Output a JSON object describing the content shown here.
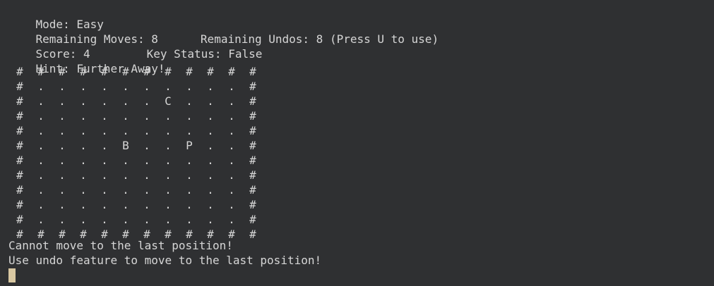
{
  "status": {
    "mode": "Mode: Easy",
    "remaining_moves": "Remaining Moves: 8",
    "remaining_undos": "Remaining Undos: 8 (Press U to use)",
    "score": "Score: 4",
    "key_status": "Key Status: False",
    "hint": "Hint: Further Away!"
  },
  "board": {
    "rows": [
      [
        "#",
        "#",
        "#",
        "#",
        "#",
        "#",
        "#",
        "#",
        "#",
        "#",
        "#",
        "#"
      ],
      [
        "#",
        ".",
        ".",
        ".",
        ".",
        ".",
        ".",
        ".",
        ".",
        ".",
        ".",
        "#"
      ],
      [
        "#",
        ".",
        ".",
        ".",
        ".",
        ".",
        ".",
        "C",
        ".",
        ".",
        ".",
        "#"
      ],
      [
        "#",
        ".",
        ".",
        ".",
        ".",
        ".",
        ".",
        ".",
        ".",
        ".",
        ".",
        "#"
      ],
      [
        "#",
        ".",
        ".",
        ".",
        ".",
        ".",
        ".",
        ".",
        ".",
        ".",
        ".",
        "#"
      ],
      [
        "#",
        ".",
        ".",
        ".",
        ".",
        "B",
        ".",
        ".",
        "P",
        ".",
        ".",
        "#"
      ],
      [
        "#",
        ".",
        ".",
        ".",
        ".",
        ".",
        ".",
        ".",
        ".",
        ".",
        ".",
        "#"
      ],
      [
        "#",
        ".",
        ".",
        ".",
        ".",
        ".",
        ".",
        ".",
        ".",
        ".",
        ".",
        "#"
      ],
      [
        "#",
        ".",
        ".",
        ".",
        ".",
        ".",
        ".",
        ".",
        ".",
        ".",
        ".",
        "#"
      ],
      [
        "#",
        ".",
        ".",
        ".",
        ".",
        ".",
        ".",
        ".",
        ".",
        ".",
        ".",
        "#"
      ],
      [
        "#",
        ".",
        ".",
        ".",
        ".",
        ".",
        ".",
        ".",
        ".",
        ".",
        ".",
        "#"
      ],
      [
        "#",
        "#",
        "#",
        "#",
        "#",
        "#",
        "#",
        "#",
        "#",
        "#",
        "#",
        "#"
      ]
    ]
  },
  "messages": [
    "Cannot move to the last position!",
    "Use undo feature to move to the last position!"
  ],
  "colors": {
    "background": "#2f3032",
    "text": "#d6d6d6",
    "cursor": "#d9c8a2"
  }
}
